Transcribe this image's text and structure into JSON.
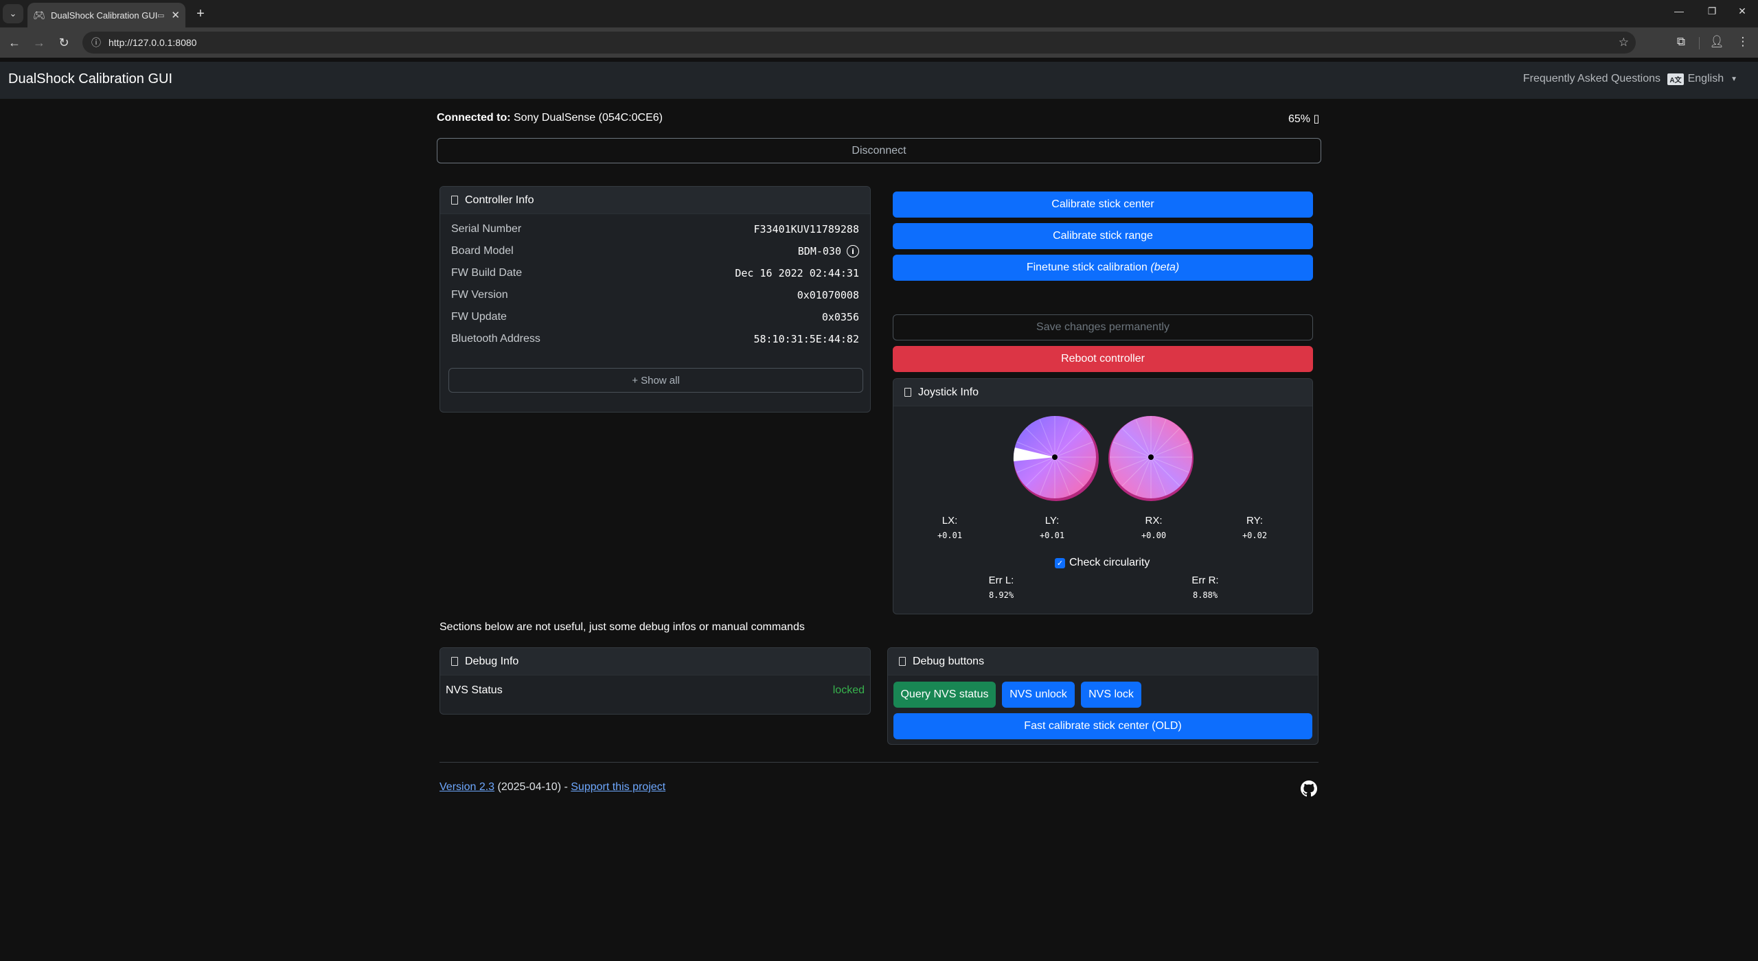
{
  "browser": {
    "tab_title": "DualShock Calibration GUI",
    "url": "http://127.0.0.1:8080",
    "tab_list_icon": "chevron-down-icon",
    "favicon_icon": "gamepad-icon",
    "new_tab_label": "+"
  },
  "navbar": {
    "brand": "DualShock Calibration GUI",
    "faq": "Frequently Asked Questions",
    "language": "English",
    "language_icon": "A文"
  },
  "connection": {
    "label": "Connected to:",
    "device": "Sony DualSense (054C:0CE6)",
    "battery": "65%",
    "disconnect": "Disconnect"
  },
  "controller_info": {
    "title": "Controller Info",
    "rows": [
      {
        "key": "Serial Number",
        "value": "F33401KUV11789288"
      },
      {
        "key": "Board Model",
        "value": "BDM-030"
      },
      {
        "key": "FW Build Date",
        "value": "Dec 16 2022 02:44:31"
      },
      {
        "key": "FW Version",
        "value": "0x01070008"
      },
      {
        "key": "FW Update",
        "value": "0x0356"
      },
      {
        "key": "Bluetooth Address",
        "value": "58:10:31:5E:44:82"
      }
    ],
    "show_all": "+ Show all"
  },
  "actions": {
    "calibrate_center": "Calibrate stick center",
    "calibrate_range": "Calibrate stick range",
    "finetune": "Finetune stick calibration",
    "finetune_beta": "(beta)",
    "save": "Save changes permanently",
    "reboot": "Reboot controller"
  },
  "joystick_info": {
    "title": "Joystick Info",
    "axes": [
      {
        "label": "LX:",
        "value": "+0.01"
      },
      {
        "label": "LY:",
        "value": "+0.01"
      },
      {
        "label": "RX:",
        "value": "+0.00"
      },
      {
        "label": "RY:",
        "value": "+0.02"
      }
    ],
    "check_circularity": "Check circularity",
    "err_l_label": "Err L:",
    "err_l_value": "8.92%",
    "err_r_label": "Err R:",
    "err_r_value": "8.88%",
    "colors": {
      "stick_a": "#8a6bff",
      "stick_b": "#ff6fb0"
    }
  },
  "debug_note": "Sections below are not useful, just some debug infos or manual commands",
  "debug_info": {
    "title": "Debug Info",
    "nvs_label": "NVS Status",
    "nvs_value": "locked",
    "nvs_color": "#37b24d"
  },
  "debug_buttons": {
    "title": "Debug buttons",
    "query": "Query NVS status",
    "unlock": "NVS unlock",
    "lock": "NVS lock",
    "fast_calibrate": "Fast calibrate stick center (OLD)"
  },
  "footer": {
    "version": "Version 2.3",
    "date": "(2025-04-10) -",
    "support": "Support this project",
    "github_icon": "github-icon"
  }
}
